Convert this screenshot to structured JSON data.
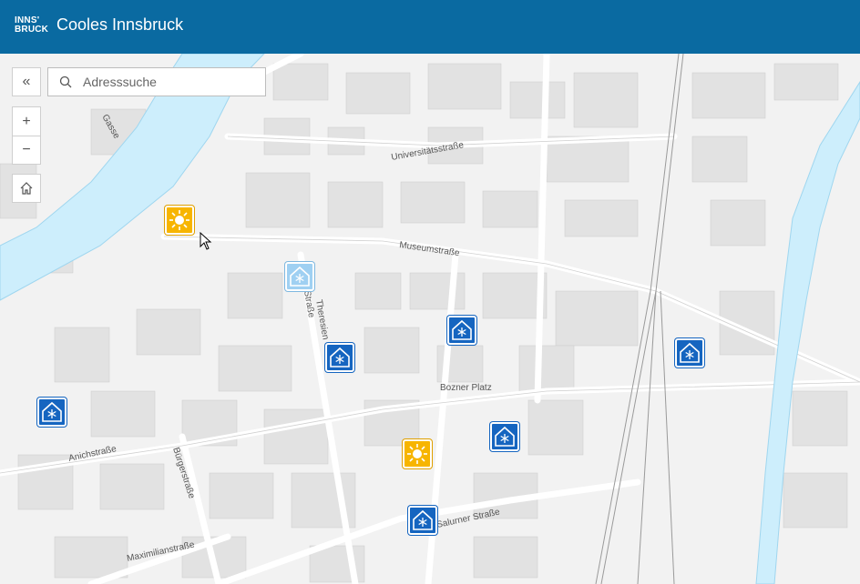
{
  "header": {
    "logo_line1": "INNS'",
    "logo_line2": "BRUCK",
    "title": "Cooles Innsbruck"
  },
  "controls": {
    "collapse_glyph": "«",
    "zoom_in_glyph": "+",
    "zoom_out_glyph": "−",
    "home_icon": "home-icon"
  },
  "search": {
    "placeholder": "Adresssuche",
    "value": ""
  },
  "streets": {
    "gasse": "Gasse",
    "universitaetsstrasse": "Universitätsstraße",
    "museumstrasse": "Museumstraße",
    "strasse": "Straße",
    "theresien": "Theresien",
    "bozner_platz": "Bozner Platz",
    "anichstrasse": "Anichstraße",
    "buergerstrasse": "Bürgerstraße",
    "salurner_strasse": "Salurner Straße",
    "maximilianstrasse": "Maximilianstraße"
  },
  "markers": {
    "sun_icon": "sun-icon",
    "cold_icon": "snowflake-house-icon"
  },
  "colors": {
    "header": "#0a6aa1",
    "river": "#cdeefc",
    "cold_marker": "#1565c0",
    "sun_marker": "#f7b500"
  }
}
